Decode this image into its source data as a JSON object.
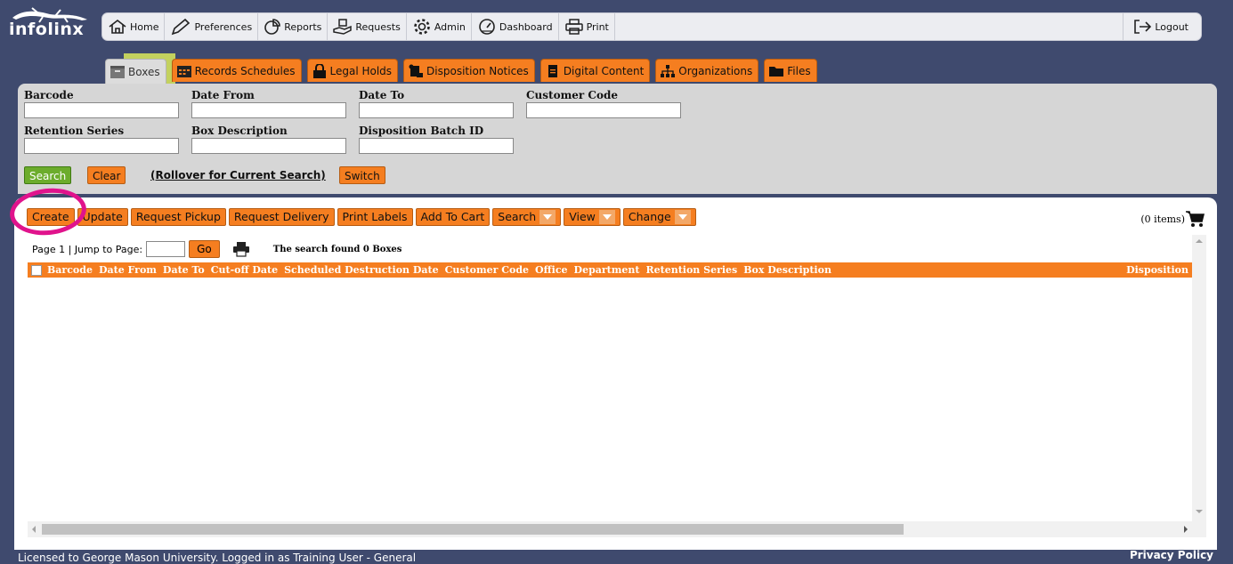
{
  "brand": {
    "name": "infolinx"
  },
  "nav": {
    "home": "Home",
    "preferences": "Preferences",
    "reports": "Reports",
    "requests": "Requests",
    "admin": "Admin",
    "dashboard": "Dashboard",
    "print": "Print",
    "logout": "Logout"
  },
  "tabs": [
    {
      "label": "Boxes",
      "active": true
    },
    {
      "label": "Records Schedules"
    },
    {
      "label": "Legal Holds"
    },
    {
      "label": "Disposition Notices"
    },
    {
      "label": "Digital Content"
    },
    {
      "label": "Organizations"
    },
    {
      "label": "Files"
    }
  ],
  "search": {
    "fields": {
      "barcode": {
        "label": "Barcode",
        "value": ""
      },
      "date_from": {
        "label": "Date From",
        "value": ""
      },
      "date_to": {
        "label": "Date To",
        "value": ""
      },
      "customer_code": {
        "label": "Customer Code",
        "value": ""
      },
      "retention_series": {
        "label": "Retention Series",
        "value": ""
      },
      "box_description": {
        "label": "Box Description",
        "value": ""
      },
      "disposition_batch_id": {
        "label": "Disposition Batch ID",
        "value": ""
      }
    },
    "search_btn": "Search",
    "clear_btn": "Clear",
    "rollover": "(Rollover for Current Search)",
    "switch_btn": "Switch"
  },
  "actions": {
    "create": "Create",
    "update": "Update",
    "request_pickup": "Request Pickup",
    "request_delivery": "Request Delivery",
    "print_labels": "Print Labels",
    "add_to_cart": "Add To Cart",
    "search": "Search",
    "view": "View",
    "change": "Change"
  },
  "cart": {
    "items": "(0 items)"
  },
  "pager": {
    "page": "Page 1 | Jump to Page:",
    "jump_value": "",
    "go": "Go",
    "found": "The search found 0 Boxes"
  },
  "grid": {
    "columns": [
      "Barcode",
      "Date From",
      "Date To",
      "Cut-off Date",
      "Scheduled Destruction Date",
      "Customer Code",
      "Office",
      "Department",
      "Retention Series",
      "Box Description"
    ],
    "last_column": "Disposition",
    "rows": []
  },
  "footer": {
    "license": "Licensed to George Mason University. Logged in as Training User - General",
    "privacy": "Privacy Policy"
  },
  "colors": {
    "background": "#3f4a6e",
    "accent_orange": "#f57e20",
    "search_green": "#6cac2c",
    "annotation_circle": "#e0138c",
    "annotation_highlight": "#f0ff5a"
  }
}
